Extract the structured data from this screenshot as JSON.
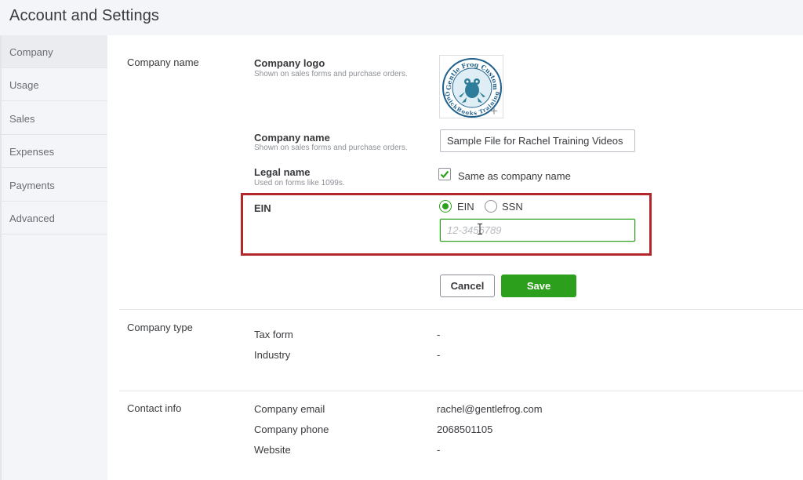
{
  "page": {
    "title": "Account and Settings"
  },
  "sidebar": {
    "items": [
      {
        "label": "Company"
      },
      {
        "label": "Usage"
      },
      {
        "label": "Sales"
      },
      {
        "label": "Expenses"
      },
      {
        "label": "Payments"
      },
      {
        "label": "Advanced"
      }
    ],
    "active": "Company"
  },
  "company_name_section": {
    "label": "Company name",
    "logo": {
      "label": "Company logo",
      "hint": "Shown on sales forms and purchase orders.",
      "logo_text_top": "Gentle Frog Custom",
      "logo_text_bottom": "QuickBooks Training",
      "add_icon": "plus-icon"
    },
    "company_name": {
      "label": "Company name",
      "hint": "Shown on sales forms and purchase orders.",
      "value": "Sample File for Rachel Training Videos"
    },
    "legal_name": {
      "label": "Legal name",
      "hint": "Used on forms like 1099s.",
      "same_as_label": "Same as company name",
      "checked": true
    },
    "ein": {
      "label": "EIN",
      "option_ein": "EIN",
      "option_ssn": "SSN",
      "selected": "EIN",
      "placeholder": "12-3456789"
    },
    "cancel_label": "Cancel",
    "save_label": "Save"
  },
  "company_type_section": {
    "label": "Company type",
    "rows": [
      {
        "label": "Tax form",
        "value": "-"
      },
      {
        "label": "Industry",
        "value": "-"
      }
    ]
  },
  "contact_info_section": {
    "label": "Contact info",
    "rows": [
      {
        "label": "Company email",
        "value": "rachel@gentlefrog.com"
      },
      {
        "label": "Company phone",
        "value": "2068501105"
      },
      {
        "label": "Website",
        "value": "-"
      }
    ]
  },
  "colors": {
    "brand_green": "#2ca01c",
    "highlight_red": "#b3272b",
    "logo_blue": "#1f5f8b",
    "logo_frog": "#2e7d9a"
  }
}
